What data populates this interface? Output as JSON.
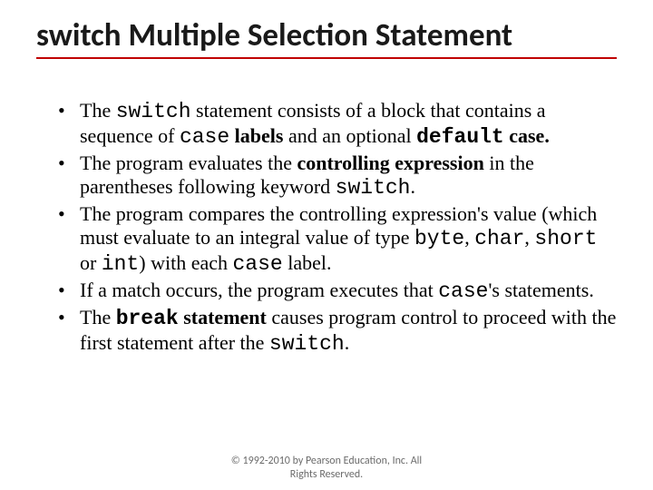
{
  "title": "switch Multiple Selection Statement",
  "kw": {
    "switch": "switch",
    "case": "case",
    "default": "default",
    "byte": "byte",
    "char": "char",
    "short": "short",
    "int": "int",
    "break": "break"
  },
  "txt": {
    "b1_a": "The ",
    "b1_b": " statement consists of a block that contains a sequence of ",
    "b1_c": " labels",
    "b1_d": " and an optional ",
    "b1_e": " case.",
    "b2_a": "The program evaluates the ",
    "b2_b": "controlling expression",
    "b2_c": " in the parentheses following keyword ",
    "b2_d": ".",
    "b3_a": "The program compares the controlling expression's value (which must evaluate to an integral value of type ",
    "b3_b": ", ",
    "b3_c": ", ",
    "b3_d": " or ",
    "b3_e": ") with each ",
    "b3_f": " label.",
    "b4_a": "If a match occurs, the program executes that ",
    "b4_b": "'s statements.",
    "b5_a": "The ",
    "b5_b": " statement",
    "b5_c": " causes program control to proceed with the first statement after the ",
    "b5_d": "."
  },
  "footer": {
    "line1": "© 1992-2010 by Pearson Education, Inc. All",
    "line2": "Rights Reserved."
  }
}
